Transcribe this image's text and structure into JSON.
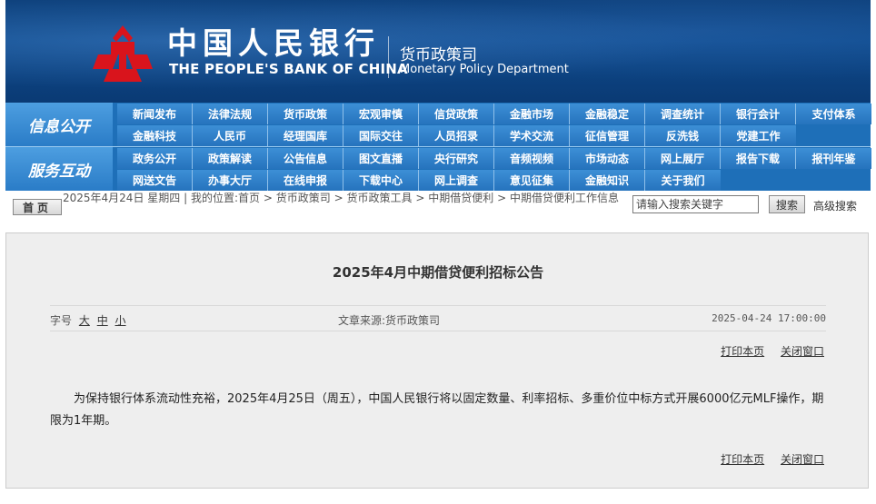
{
  "banner": {
    "bank_name_cn": "中国人民银行",
    "bank_name_en": "THE PEOPLE'S BANK OF CHINA",
    "dept_cn": "货币政策司",
    "dept_en": "Monetary Policy Department",
    "logo_color": "#d9141c"
  },
  "nav": {
    "info_label": "信息公开",
    "service_label": "服务互动",
    "info_row1": [
      "新闻发布",
      "法律法规",
      "货币政策",
      "宏观审慎",
      "信贷政策",
      "金融市场",
      "金融稳定",
      "调查统计",
      "银行会计",
      "支付体系"
    ],
    "info_row2": [
      "金融科技",
      "人民币",
      "经理国库",
      "国际交往",
      "人员招录",
      "学术交流",
      "征信管理",
      "反洗钱",
      "党建工作"
    ],
    "service_row1": [
      "政务公开",
      "政策解读",
      "公告信息",
      "图文直播",
      "央行研究",
      "音频视频",
      "市场动态",
      "网上展厅",
      "报告下载",
      "报刊年鉴"
    ],
    "service_row2": [
      "网送文告",
      "办事大厅",
      "在线申报",
      "下载中心",
      "网上调查",
      "意见征集",
      "金融知识",
      "关于我们"
    ]
  },
  "crumbbar": {
    "home_label": "首页",
    "date": "2025年4月24日",
    "weekday": "星期四",
    "location_prefix": "我的位置:",
    "crumbs": [
      "首页",
      "货币政策司",
      "货币政策工具",
      "中期借贷便利",
      "中期借贷便利工作信息"
    ],
    "search_placeholder": "请输入搜索关键字",
    "search_button": "搜索",
    "advanced_search": "高级搜索"
  },
  "article": {
    "title": "2025年4月中期借贷便利招标公告",
    "fontsize_label": "字号",
    "fontsize_large": "大",
    "fontsize_medium": "中",
    "fontsize_small": "小",
    "source": "文章来源:货币政策司",
    "date": "2025-04-24 17:00:00",
    "print_label": "打印本页",
    "close_label": "关闭窗口",
    "body": "为保持银行体系流动性充裕，2025年4月25日（周五），中国人民银行将以固定数量、利率招标、多重价位中标方式开展6000亿元MLF操作，期限为1年期。"
  }
}
